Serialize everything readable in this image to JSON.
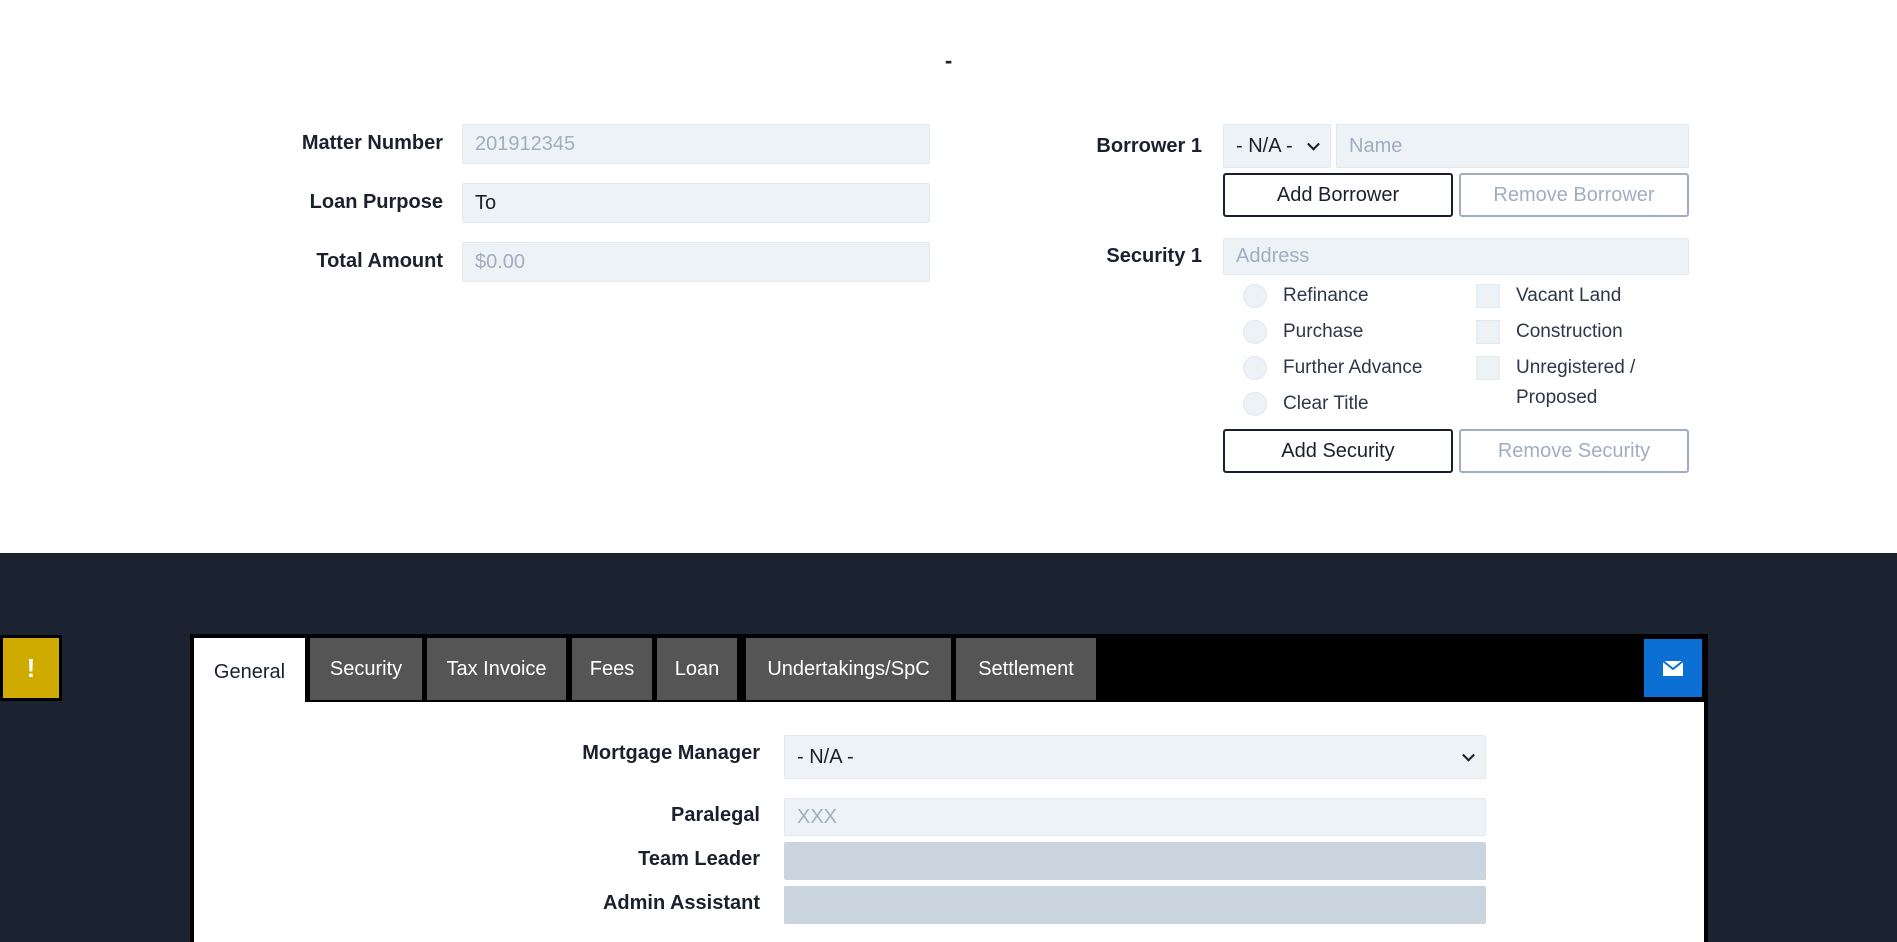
{
  "page": {
    "title": "-"
  },
  "matter": {
    "matter_number_label": "Matter Number",
    "matter_number_placeholder": "201912345",
    "loan_purpose_label": "Loan Purpose",
    "loan_purpose_value": "To",
    "total_amount_label": "Total Amount",
    "total_amount_placeholder": "$0.00"
  },
  "borrower": {
    "label": "Borrower 1",
    "title_select": "- N/A -",
    "name_placeholder": "Name",
    "add_label": "Add Borrower",
    "remove_label": "Remove Borrower"
  },
  "security": {
    "label": "Security 1",
    "address_placeholder": "Address",
    "radios": [
      "Refinance",
      "Purchase",
      "Further Advance",
      "Clear Title"
    ],
    "checkboxes": [
      "Vacant Land",
      "Construction",
      "Unregistered /",
      "Proposed"
    ],
    "add_label": "Add Security",
    "remove_label": "Remove Security"
  },
  "alert": {
    "icon": "exclamation-icon",
    "glyph": "!"
  },
  "tabs": [
    "General",
    "Security",
    "Tax Invoice",
    "Fees",
    "Loan",
    "Undertakings/SpC",
    "Settlement"
  ],
  "mail": {
    "icon": "envelope-icon"
  },
  "general": {
    "mortgage_manager_label": "Mortgage Manager",
    "mortgage_manager_value": "- N/A -",
    "paralegal_label": "Paralegal",
    "paralegal_placeholder": "XXX",
    "team_leader_label": "Team Leader",
    "team_leader_value": "",
    "admin_assistant_label": "Admin Assistant",
    "admin_assistant_value": ""
  },
  "colors": {
    "dark_band": "#1b2330",
    "alert": "#cfab00",
    "mail": "#0b6fd3",
    "tab_inactive": "#555555",
    "field_bg": "#edf2f7"
  }
}
